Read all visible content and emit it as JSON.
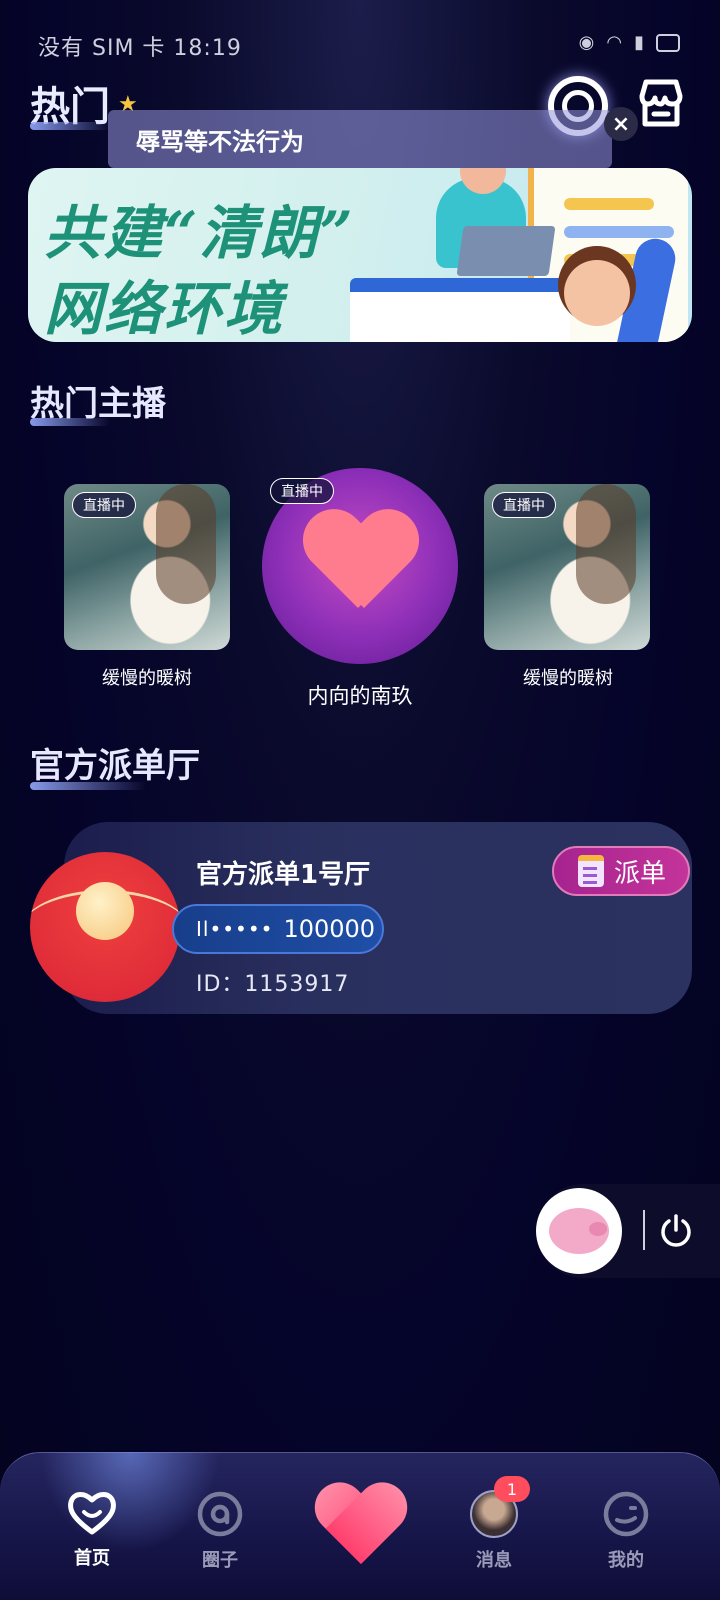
{
  "status_bar": {
    "left_text": "没有 SIM 卡 18:19"
  },
  "header": {
    "hot_title": "热门"
  },
  "toast": {
    "text": "辱骂等不法行为"
  },
  "banner": {
    "line1": "共建“清朗”",
    "line2": "网络环境"
  },
  "sections": {
    "hot_anchors": "热门主播",
    "official_hall": "官方派单厅"
  },
  "anchors": [
    {
      "name": "缓慢的暖树",
      "badge": "直播中"
    },
    {
      "name": "内向的南玖",
      "badge": "直播中"
    },
    {
      "name": "缓慢的暖树",
      "badge": "直播中"
    }
  ],
  "hall": {
    "name": "官方派单1号厅",
    "signal": "Il•••••",
    "value": "100000",
    "id_text": "ID：1153917",
    "action_label": "派单"
  },
  "tabbar": {
    "items": [
      {
        "label": "首页",
        "active": true
      },
      {
        "label": "圈子",
        "active": false
      },
      {
        "label": "消息",
        "active": false,
        "badge": "1"
      },
      {
        "label": "我的",
        "active": false
      }
    ]
  },
  "colors": {
    "background": "#05042a",
    "accent_pink": "#c4349a",
    "pill_blue": "#1f4fa8",
    "badge_red": "#ff4d5e"
  }
}
